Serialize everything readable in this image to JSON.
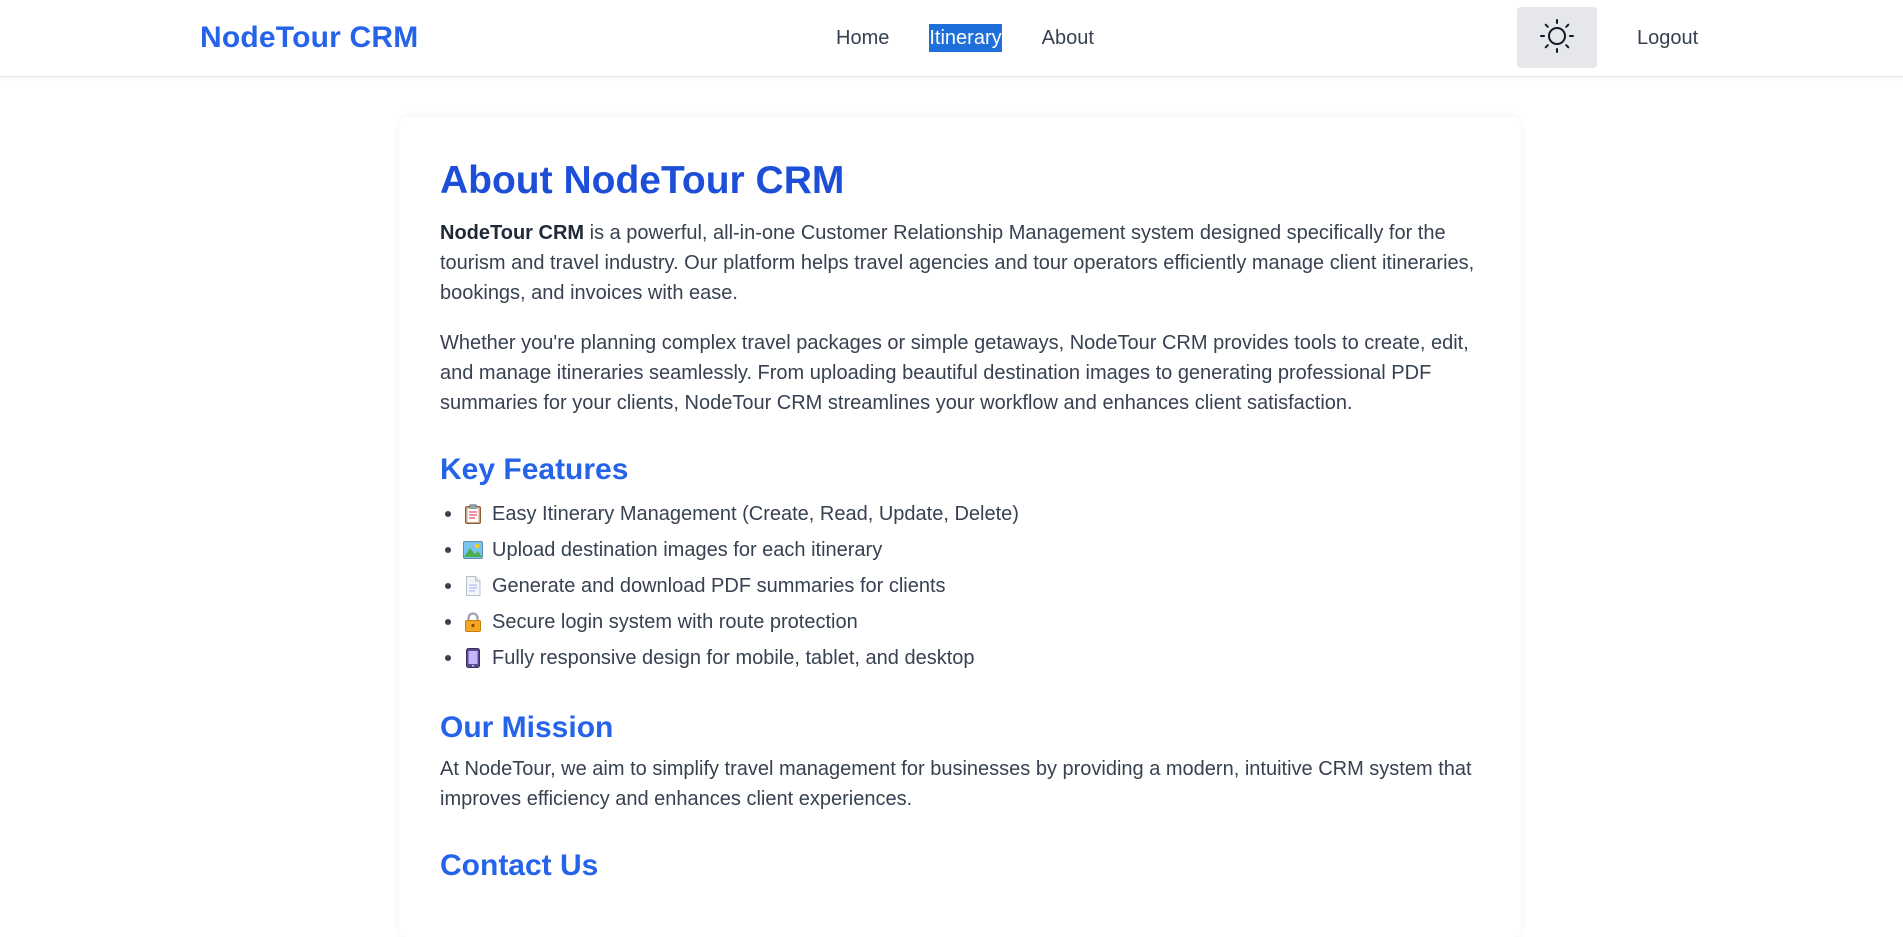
{
  "nav": {
    "brand": "NodeTour CRM",
    "links": [
      "Home",
      "Itinerary",
      "About"
    ],
    "logout": "Logout",
    "theme_icon": "sun-icon",
    "accent_color": "#2563eb",
    "selection_color": "#1e6fd9"
  },
  "about": {
    "title": "About NodeTour CRM",
    "intro_bold": "NodeTour CRM",
    "intro_rest": " is a powerful, all-in-one Customer Relationship Management system designed specifically for the tourism and travel industry. Our platform helps travel agencies and tour operators efficiently manage client itineraries, bookings, and invoices with ease.",
    "second_para": "Whether you're planning complex travel packages or simple getaways, NodeTour CRM provides tools to create, edit, and manage itineraries seamlessly. From uploading beautiful destination images to generating professional PDF summaries for your clients, NodeTour CRM streamlines your workflow and enhances client satisfaction."
  },
  "key_features": {
    "heading": "Key Features",
    "items": [
      {
        "icon": "clipboard-icon",
        "text": "Easy Itinerary Management (Create, Read, Update, Delete)"
      },
      {
        "icon": "picture-icon",
        "text": "Upload destination images for each itinerary"
      },
      {
        "icon": "document-icon",
        "text": "Generate and download PDF summaries for clients"
      },
      {
        "icon": "lock-icon",
        "text": "Secure login system with route protection"
      },
      {
        "icon": "phone-icon",
        "text": "Fully responsive design for mobile, tablet, and desktop"
      }
    ]
  },
  "mission": {
    "heading": "Our Mission",
    "text": "At NodeTour, we aim to simplify travel management for businesses by providing a modern, intuitive CRM system that improves efficiency and enhances client experiences."
  },
  "contact": {
    "heading": "Contact Us"
  }
}
